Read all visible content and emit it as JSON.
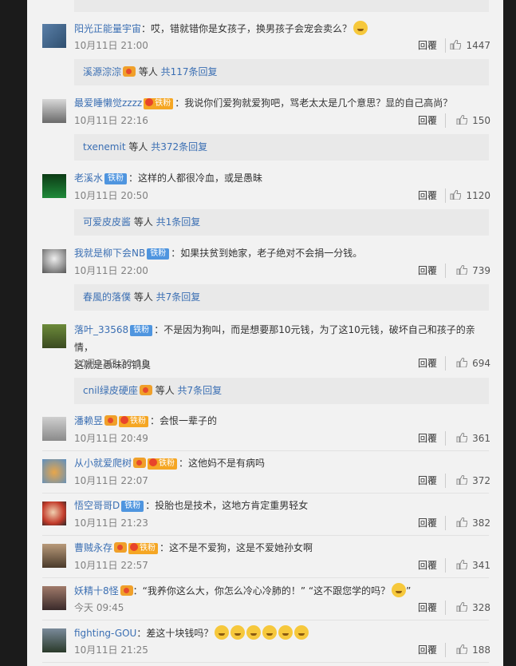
{
  "reply_label": "回覆",
  "comments": [
    {
      "user": "阳光正能量宇宙",
      "badge": "",
      "medal": false,
      "text": "：哎，错就错你是女孩子，换男孩子会宠会卖么？",
      "emoji": true,
      "time": "10月11日 21:00",
      "likes": "1447"
    },
    {
      "user": "最爱睡懒觉zzzz",
      "badge": "铁粉",
      "medal": true,
      "text": "：我说你们爱狗就爱狗吧，骂老太太是几个意思？显的自己高尚？",
      "time": "10月11日 22:16",
      "likes": "150"
    },
    {
      "user": "老溪水",
      "badge": "铁粉",
      "text": "：这样的人都很冷血，或是愚昧",
      "time": "10月11日 20:50",
      "likes": "1120"
    },
    {
      "user": "我就是柳下会NB",
      "badge": "铁粉",
      "text": "：如果扶贫到她家，老子绝对不会捐一分钱。",
      "time": "10月11日 22:00",
      "likes": "739"
    },
    {
      "user": "落叶_33568",
      "badge": "铁粉",
      "text": "：不是因为狗叫，而是想要那10元钱，为了这10元钱，破坏自己和孩子的亲情，",
      "text2": "这就是愚昧的铜臭",
      "time": "10月11日 22:13",
      "likes": "694"
    },
    {
      "user": "潘赖昱",
      "badge": "铁粉",
      "medal": true,
      "text": "：会恨一辈子的",
      "time": "10月11日 20:49",
      "likes": "361"
    },
    {
      "user": "从小就爱爬树",
      "badge": "铁粉",
      "medal": true,
      "text": "：这他妈不是有病吗",
      "time": "10月11日 22:07",
      "likes": "372"
    },
    {
      "user": "悟空哥哥D",
      "badge": "铁粉",
      "text": "：投胎也是技术，这地方肯定重男轻女",
      "time": "10月11日 21:23",
      "likes": "382"
    },
    {
      "user": "曹贼永存",
      "badge": "铁粉",
      "medal": true,
      "text": "：这不是不爱狗，这是不爱她孙女啊",
      "time": "10月11日 22:57",
      "likes": "341"
    },
    {
      "user": "妖精十8怪",
      "medal": true,
      "text": "：“我养你这么大，你怎么冷心冷肺的！” “这不跟您学的吗？",
      "text_end": "”",
      "time": "今天 09:45",
      "likes": "328"
    },
    {
      "user": "fighting-GOU",
      "text": "：差这十块钱吗？",
      "time": "10月11日 21:25",
      "likes": "188"
    }
  ],
  "subreplies": [
    {
      "user": "溪源淙淙",
      "medal": true,
      "mid": " 等人 ",
      "more": "共117条回复"
    },
    {
      "user": "txenemit",
      "mid": " 等人 ",
      "more": "共372条回复"
    },
    {
      "user": "可爱皮皮酱",
      "mid": " 等人 ",
      "more": "共1条回复"
    },
    {
      "user": "春風的落僕",
      "mid": " 等人 ",
      "more": "共7条回复"
    },
    {
      "user": "cnil绿皮硬座",
      "medal": true,
      "mid": " 等人 ",
      "more": "共7条回复"
    }
  ]
}
